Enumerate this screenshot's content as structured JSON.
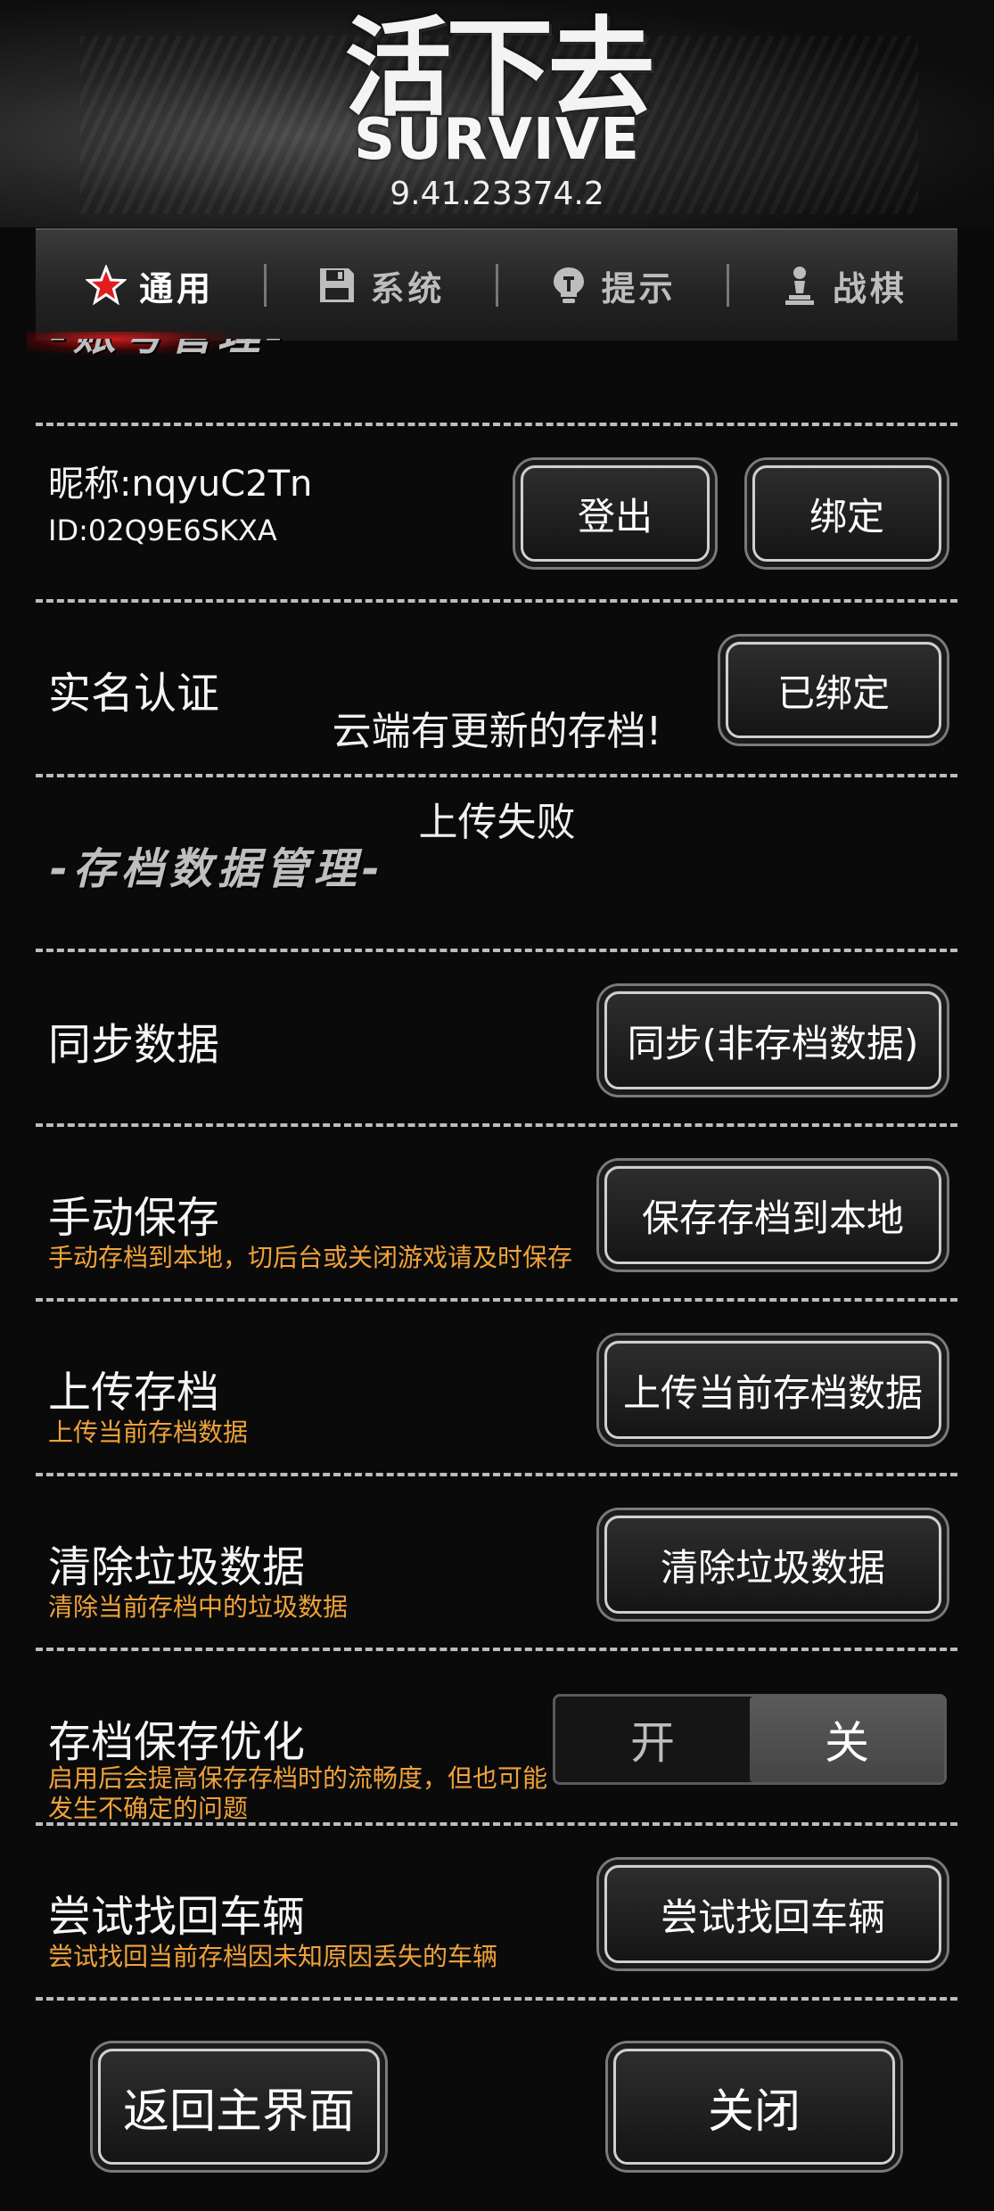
{
  "header": {
    "title_cn": "活下去",
    "title_en": "SURVIVE",
    "version": "9.41.23374.2"
  },
  "tabs": [
    {
      "label": "通用",
      "icon": "star-icon",
      "active": true
    },
    {
      "label": "系统",
      "icon": "save-disk-icon",
      "active": false
    },
    {
      "label": "提示",
      "icon": "lightbulb-icon",
      "active": false
    },
    {
      "label": "战棋",
      "icon": "chess-pawn-icon",
      "active": false
    }
  ],
  "account": {
    "section_title": "-账号管理-",
    "nickname": "昵称:nqyuC2Tn",
    "id": "ID:02Q9E6SKXA",
    "logout_label": "登出",
    "bind_label": "绑定",
    "realname_label": "实名认证",
    "realname_button": "已绑定"
  },
  "toasts": {
    "cloud_update": "云端有更新的存档!",
    "upload_failed": "上传失败"
  },
  "save_section": {
    "title": "-存档数据管理-",
    "rows": [
      {
        "label": "同步数据",
        "sub": "",
        "button": "同步(非存档数据)"
      },
      {
        "label": "手动保存",
        "sub": "手动存档到本地，切后台或关闭游戏请及时保存",
        "button": "保存存档到本地"
      },
      {
        "label": "上传存档",
        "sub": "上传当前存档数据",
        "button": "上传当前存档数据"
      },
      {
        "label": "清除垃圾数据",
        "sub": "清除当前存档中的垃圾数据",
        "button": "清除垃圾数据"
      }
    ],
    "optimize": {
      "label": "存档保存优化",
      "sub": "启用后会提高保存存档时的流畅度，但也可能发生不确定的问题",
      "on_label": "开",
      "off_label": "关",
      "selected": "关"
    },
    "recover": {
      "label": "尝试找回车辆",
      "sub": "尝试找回当前存档因未知原因丢失的车辆",
      "button": "尝试找回车辆"
    }
  },
  "footer": {
    "back_label": "返回主界面",
    "close_label": "关闭"
  },
  "colors": {
    "accent_red": "#e01e1e",
    "sub_text_orange": "#f0a23a",
    "background": "#0a0a0a"
  }
}
